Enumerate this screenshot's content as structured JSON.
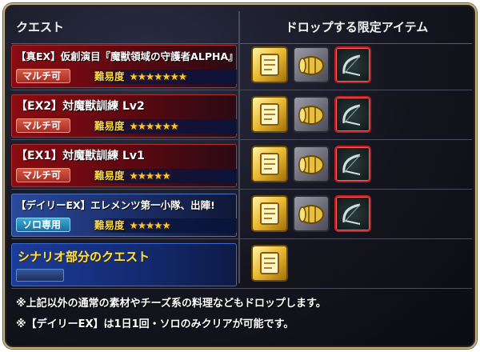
{
  "header": {
    "quest_col": "クエスト",
    "drop_col": "ドロップする限定アイテム"
  },
  "difficulty_label": "難易度",
  "rows": [
    {
      "title": "【真EX】仮創演目『魔獣領域の守護者ALPHA』",
      "tag": "マルチ可",
      "stars": "★★★★★★★",
      "star_count": 7,
      "drops": [
        "ticket-icon",
        "capsule-icon",
        "bow-icon"
      ]
    },
    {
      "title": "【EX2】対魔獣訓練 Lv2",
      "tag": "マルチ可",
      "stars": "★★★★★★",
      "star_count": 6,
      "drops": [
        "ticket-icon",
        "capsule-icon",
        "bow-icon"
      ]
    },
    {
      "title": "【EX1】対魔獣訓練 Lv1",
      "tag": "マルチ可",
      "stars": "★★★★★",
      "star_count": 5,
      "drops": [
        "ticket-icon",
        "capsule-icon",
        "bow-icon"
      ]
    },
    {
      "title": "【デイリーEX】エレメンツ第一小隊、出陣!",
      "tag": "ソロ専用",
      "stars": "★★★★★",
      "star_count": 5,
      "drops": [
        "ticket-icon",
        "capsule-icon",
        "bow-icon"
      ]
    },
    {
      "title": "シナリオ部分のクエスト",
      "drops": [
        "ticket-icon"
      ]
    }
  ],
  "notes": [
    "※上記以外の通常の素材やチーズ系の料理などもドロップします。",
    "※【デイリーEX】は1日1回・ソロのみクリアが可能です。"
  ],
  "colors": {
    "accent_gold": "#ffd94a",
    "multi_tag": "#c84032",
    "solo_tag": "#2a8ab8",
    "hard_row": "#8b0b12",
    "daily_row": "#2a4a9a"
  }
}
